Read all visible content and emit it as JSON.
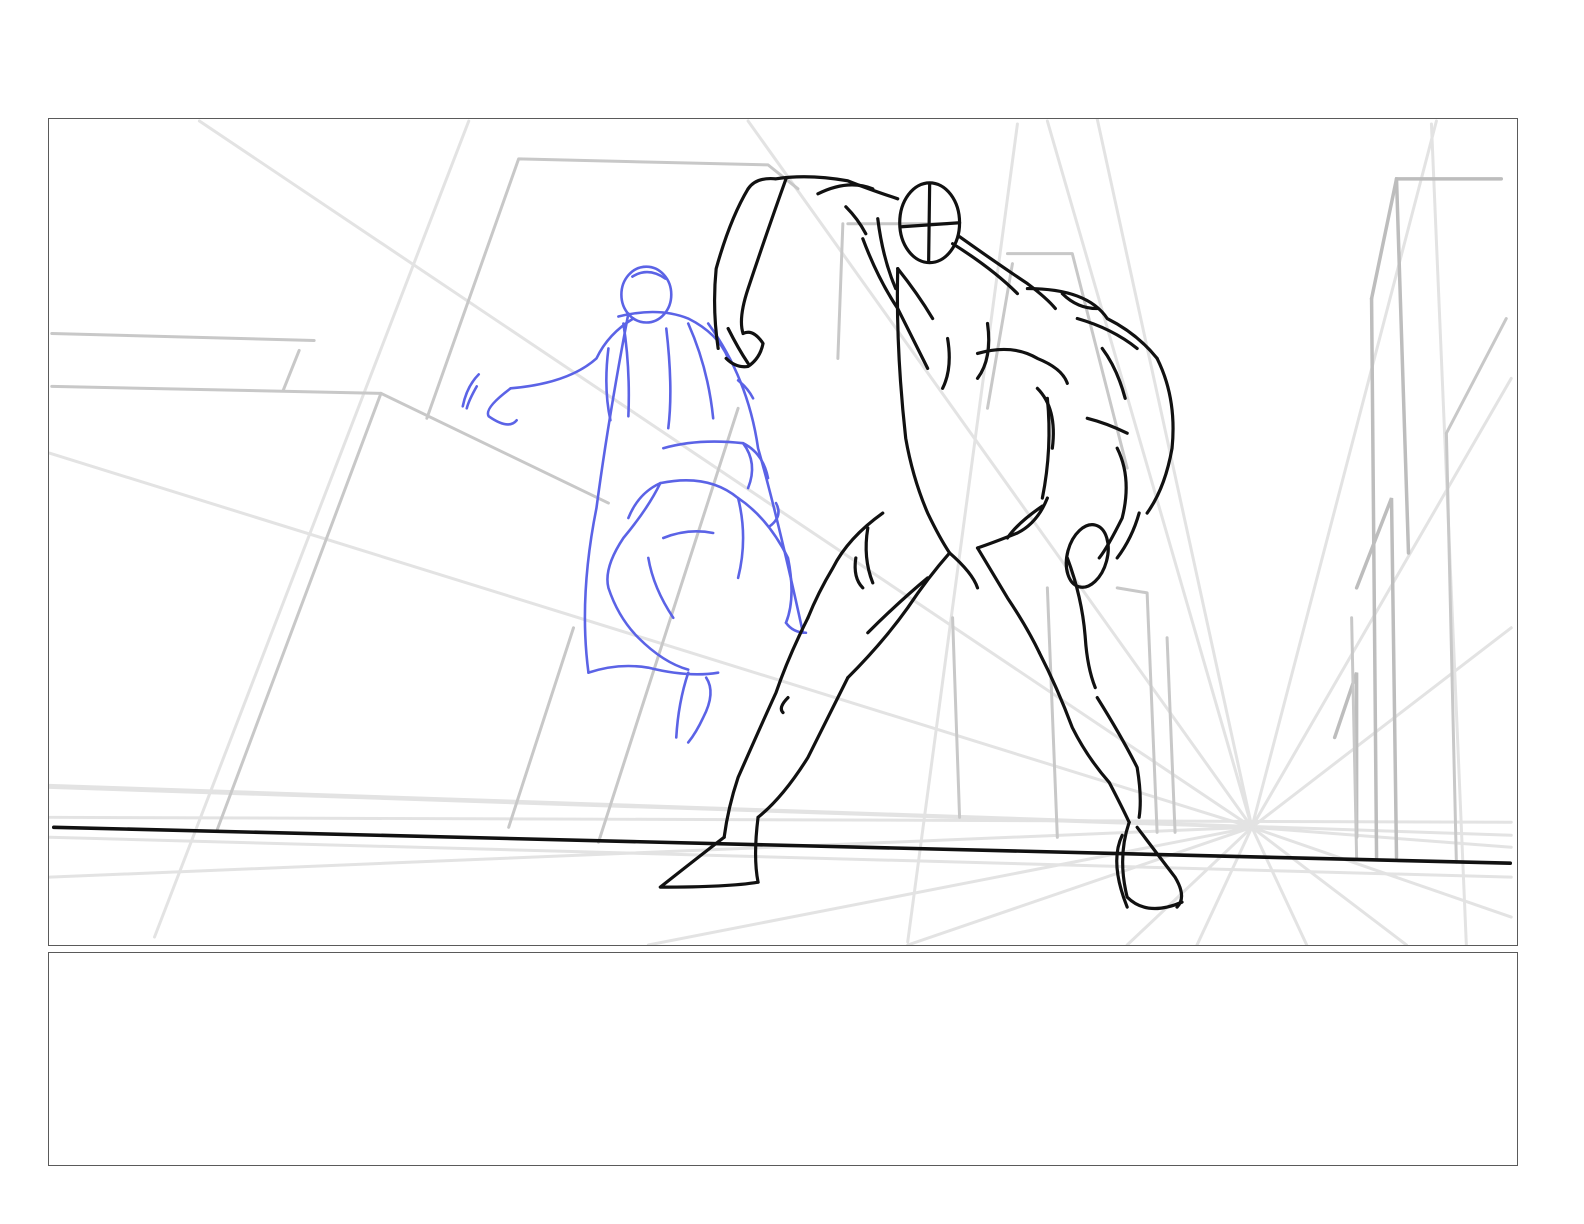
{
  "storyboard": {
    "frame_panel": {
      "sketch_layers": [
        "perspective-guides",
        "buildings",
        "ground-line",
        "caped-hero",
        "masked-brute"
      ],
      "colors": {
        "guides": "#e3e3e3",
        "buildings": "#c8c8c8",
        "ink": "#111111",
        "rough_figure": "#5b63e6"
      }
    },
    "notes_panel": {
      "text": ""
    }
  }
}
